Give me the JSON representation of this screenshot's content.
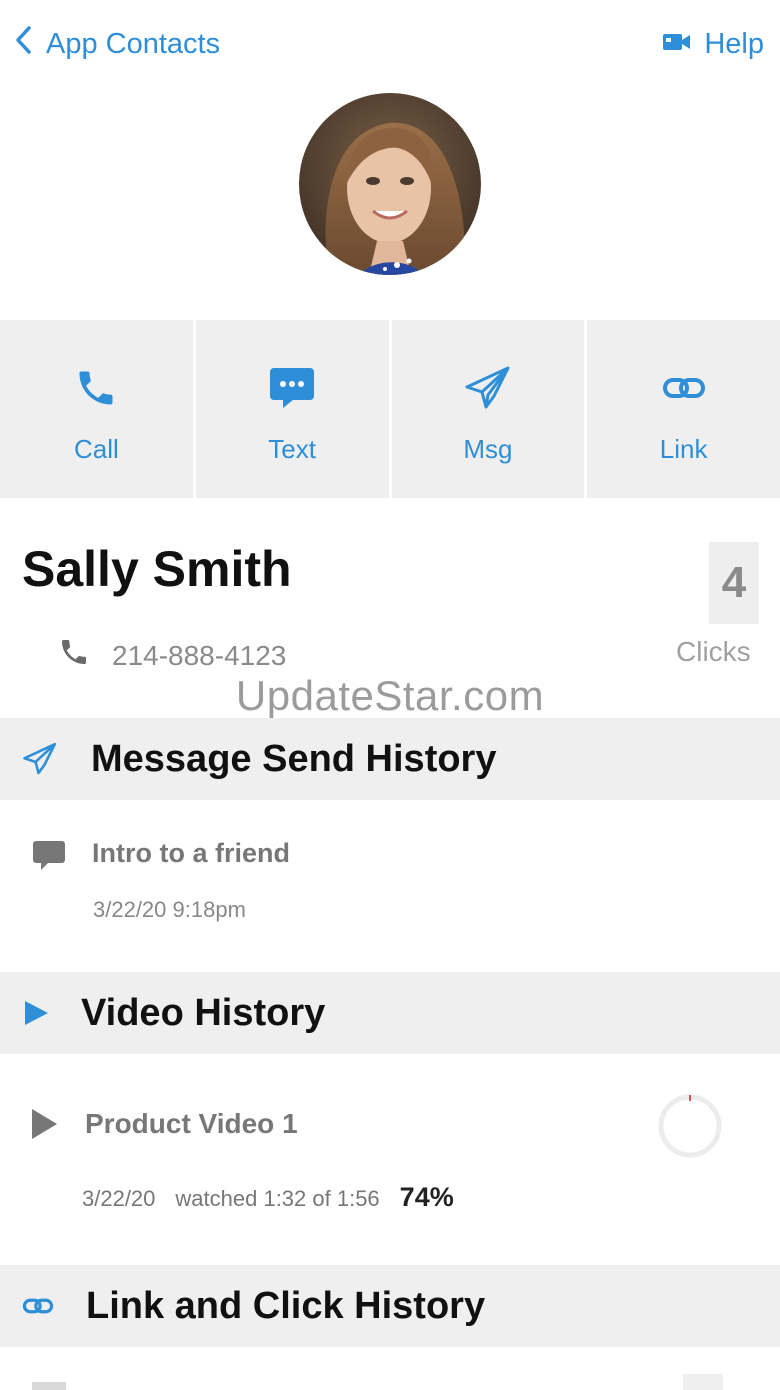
{
  "header": {
    "back_label": "App Contacts",
    "help_label": "Help"
  },
  "actions": [
    {
      "label": "Call",
      "icon": "phone-icon"
    },
    {
      "label": "Text",
      "icon": "chat-bubble-icon"
    },
    {
      "label": "Msg",
      "icon": "paper-plane-icon"
    },
    {
      "label": "Link",
      "icon": "link-icon"
    }
  ],
  "contact": {
    "name": "Sally Smith",
    "phone": "214-888-4123",
    "clicks_count": "4",
    "clicks_label": "Clicks"
  },
  "watermark": "UpdateStar.com",
  "sections": {
    "message_history": {
      "title": "Message Send History",
      "items": [
        {
          "title": "Intro to a friend",
          "date": "3/22/20 9:18pm"
        }
      ]
    },
    "video_history": {
      "title": "Video History",
      "items": [
        {
          "title": "Product Video 1",
          "date": "3/22/20",
          "watched": "watched 1:32 of 1:56",
          "percent": "74%"
        }
      ]
    },
    "link_history": {
      "title": "Link and Click History"
    }
  },
  "colors": {
    "accent": "#2e8fd8",
    "panel": "#efefef",
    "text_dark": "#111111",
    "text_muted": "#8a8a8a"
  }
}
